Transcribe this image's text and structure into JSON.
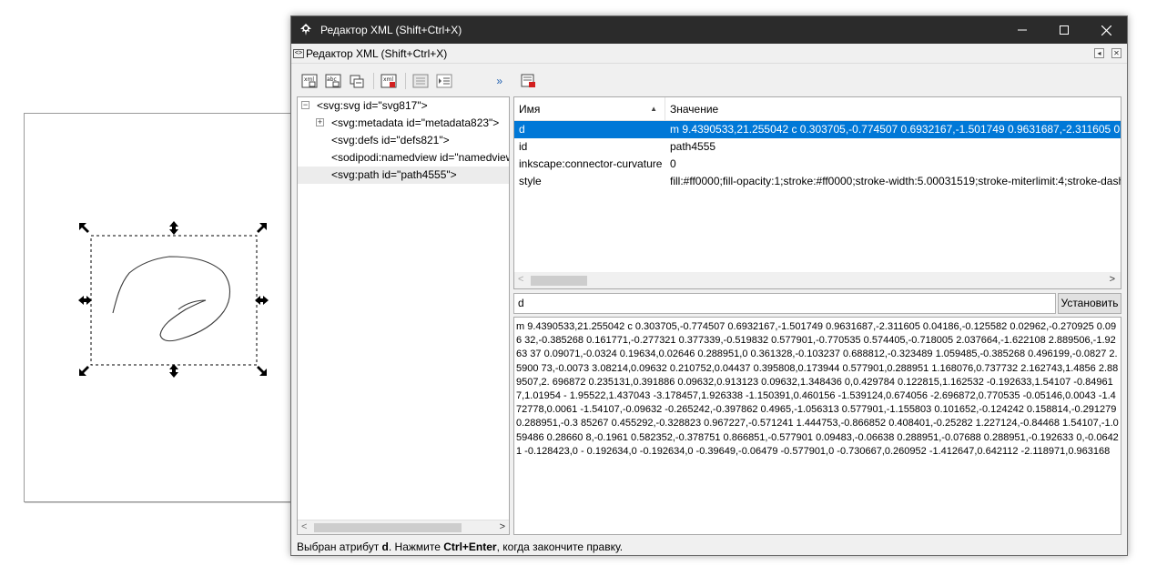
{
  "canvas": {
    "page_label": "",
    "colors": {
      "handle": "#000000",
      "stroke": "#000000"
    }
  },
  "window": {
    "title": "Редактор XML (Shift+Ctrl+X)",
    "controls": {
      "minimize": "—",
      "maximize": "☐",
      "close": "✕"
    }
  },
  "dock": {
    "title": "Редактор XML (Shift+Ctrl+X)"
  },
  "toolbar": {
    "buttons": [
      {
        "icon": "new-element-node-icon",
        "label": "xml"
      },
      {
        "icon": "new-text-node-icon",
        "label": "abc"
      },
      {
        "icon": "duplicate-node-icon",
        "label": ""
      },
      {
        "icon": "delete-node-icon",
        "label": "xml"
      },
      {
        "icon": "unindent-node-icon",
        "label": ""
      },
      {
        "icon": "indent-node-icon",
        "label": ""
      }
    ],
    "more": "»"
  },
  "tree": {
    "nodes": [
      {
        "label": "<svg:svg id=\"svg817\">",
        "indent": 0,
        "expander": "−",
        "selected": false
      },
      {
        "label": "<svg:metadata id=\"metadata823\">",
        "indent": 1,
        "expander": "+",
        "selected": false
      },
      {
        "label": "<svg:defs id=\"defs821\">",
        "indent": 1,
        "expander": "",
        "selected": false
      },
      {
        "label": "<sodipodi:namedview id=\"namedview",
        "indent": 1,
        "expander": "",
        "selected": false
      },
      {
        "label": "<svg:path id=\"path4555\">",
        "indent": 1,
        "expander": "",
        "selected": true
      }
    ],
    "scroll_left": "<",
    "scroll_right": ">"
  },
  "attributes": {
    "header_name": "Имя",
    "header_value": "Значение",
    "sort_indicator": "▲",
    "rows": [
      {
        "name": "d",
        "value": "m 9.4390533,21.255042 c 0.303705,-0.774507 0.6932167,-1.501749 0.9631687,-2.311605 0.04186,-0.125582 0.02962,-0.270925 0.096",
        "selected": true
      },
      {
        "name": "id",
        "value": "path4555",
        "selected": false
      },
      {
        "name": "inkscape:connector-curvature",
        "value": "0",
        "selected": false
      },
      {
        "name": "style",
        "value": "fill:#ff0000;fill-opacity:1;stroke:#ff0000;stroke-width:5.00031519;stroke-miterlimit:4;stroke-dash",
        "selected": false
      }
    ],
    "scroll_left": "<",
    "scroll_right": ">"
  },
  "editor": {
    "attr_name": "d",
    "set_button": "Установить",
    "value": "m 9.4390533,21.255042 c 0.303705,-0.774507 0.6932167,-1.501749 0.9631687,-2.311605 0.04186,-0.125582 0.02962,-0.270925 0.096 32,-0.385268 0.161771,-0.277321 0.377339,-0.519832 0.577901,-0.770535 0.574405,-0.718005 2.037664,-1.622108 2.889506,-1.9263 37 0.09071,-0.0324 0.19634,0.02646 0.288951,0 0.361328,-0.103237 0.688812,-0.323489 1.059485,-0.385268 0.496199,-0.0827 2.5900 73,-0.0073 3.08214,0.09632 0.210752,0.04437 0.395808,0.173944 0.577901,0.288951 1.168076,0.737732 2.162743,1.4856 2.889507,2. 696872 0.235131,0.391886 0.09632,0.913123 0.09632,1.348436 0,0.429784 0.122815,1.162532 -0.192633,1.54107 -0.849617,1.01954 - 1.95522,1.437043 -3.178457,1.926338 -1.150391,0.460156 -1.539124,0.674056 -2.696872,0.770535 -0.05146,0.0043 -1.472778,0.0061 -1.54107,-0.09632 -0.265242,-0.397862 0.4965,-1.056313 0.577901,-1.155803 0.101652,-0.124242 0.158814,-0.291279 0.288951,-0.3 85267 0.455292,-0.328823 0.967227,-0.571241 1.444753,-0.866852 0.408401,-0.25282 1.227124,-0.84468 1.54107,-1.059486 0.28660 8,-0.1961 0.582352,-0.378751 0.866851,-0.577901 0.09483,-0.06638 0.288951,-0.07688 0.288951,-0.192633 0,-0.06421 -0.128423,0 - 0.192634,0 -0.192634,0 -0.39649,-0.06479 -0.577901,0 -0.730667,0.260952 -1.412647,0.642112 -2.118971,0.963168"
  },
  "status": {
    "prefix": "Выбран атрибут ",
    "attr": "d",
    "middle": ". Нажмите ",
    "shortcut": "Ctrl+Enter",
    "suffix": ", когда закончите правку."
  }
}
